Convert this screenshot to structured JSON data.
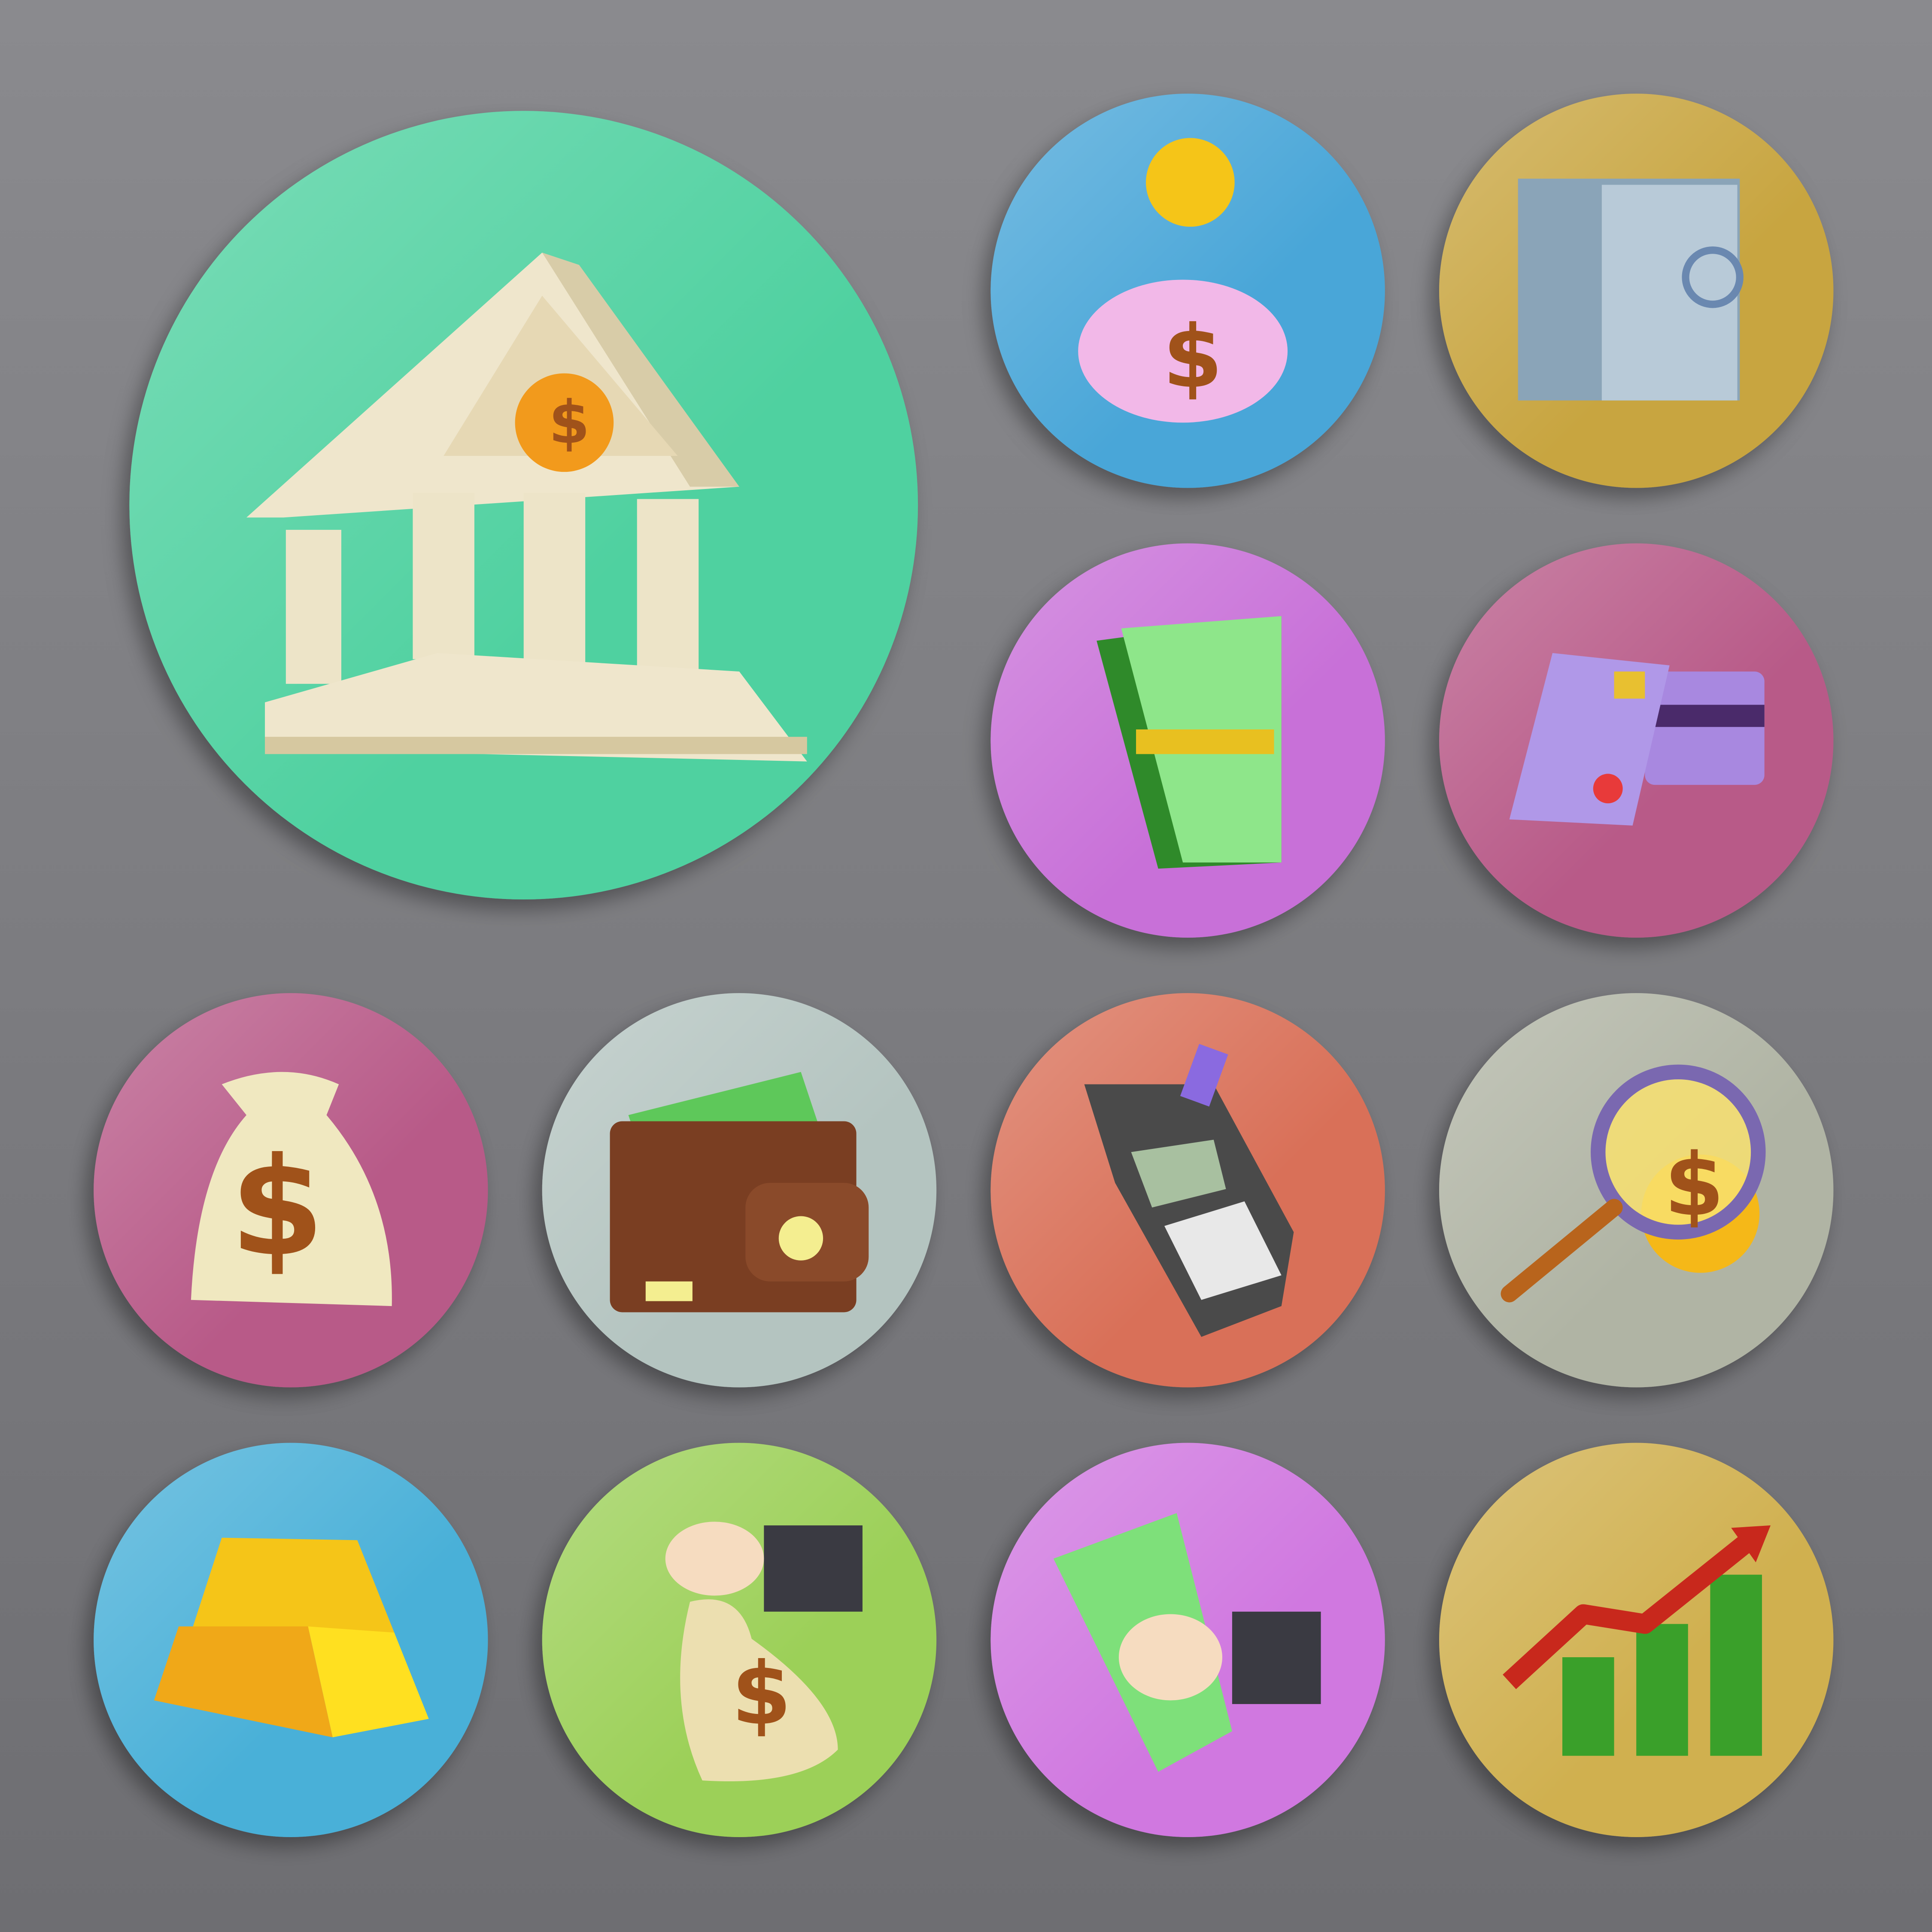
{
  "background": {
    "top": "#8a8a8e",
    "bottom": "#6e6e72"
  },
  "dollar_sign": "$",
  "icons": [
    {
      "name": "bank",
      "color": "#4fd1a0"
    },
    {
      "name": "piggy-bank",
      "color": "#4aa6d8"
    },
    {
      "name": "safe",
      "color": "#c8a540"
    },
    {
      "name": "money-stack",
      "color": "#c870d8"
    },
    {
      "name": "credit-cards",
      "color": "#b85a88"
    },
    {
      "name": "money-bag",
      "color": "#b85a88"
    },
    {
      "name": "wallet",
      "color": "#b4c4c0"
    },
    {
      "name": "card-terminal",
      "color": "#d97058"
    },
    {
      "name": "magnifier-coin",
      "color": "#b0b4a4"
    },
    {
      "name": "gold-bars",
      "color": "#4ab0d8"
    },
    {
      "name": "hand-money-bag",
      "color": "#9cd058"
    },
    {
      "name": "hand-banknote",
      "color": "#d078e0"
    },
    {
      "name": "growth-chart",
      "color": "#d0b050"
    }
  ]
}
